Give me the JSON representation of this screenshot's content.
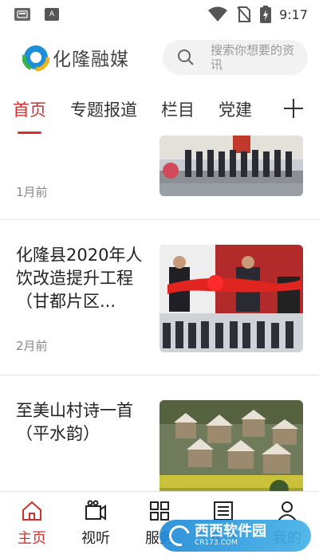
{
  "status_bar": {
    "left_icons": [
      "notification-icon",
      "app-a-icon"
    ],
    "app_a_text": "A",
    "right_icons": [
      "wifi-icon",
      "no-sim-icon",
      "battery-charging-icon"
    ],
    "time": "9:17"
  },
  "header": {
    "logo_text": "化隆融媒",
    "search_placeholder": "搜索你想要的资讯"
  },
  "tabs": [
    {
      "label": "首页",
      "active": true
    },
    {
      "label": "专题报道",
      "active": false
    },
    {
      "label": "栏目",
      "active": false
    },
    {
      "label": "党建",
      "active": false
    }
  ],
  "feed": [
    {
      "title": "",
      "time": "1月前",
      "image": "ceremony-group-photo"
    },
    {
      "title": "化隆县2020年人饮改造提升工程（甘都片区...",
      "time": "2月前",
      "image": "ribbon-cutting-event"
    },
    {
      "title": "至美山村诗一首（平水韵）",
      "time": "",
      "image": "mountain-village-landscape"
    }
  ],
  "bottom_nav": [
    {
      "label": "主页",
      "icon": "home-icon",
      "active": true
    },
    {
      "label": "视听",
      "icon": "video-icon",
      "active": false
    },
    {
      "label": "服务",
      "icon": "grid-icon",
      "active": false
    },
    {
      "label": "報道",
      "icon": "newspaper-icon",
      "active": false
    },
    {
      "label": "我的",
      "icon": "user-icon",
      "active": false
    }
  ],
  "watermark": {
    "text": "西西软件园",
    "sub": "CR173.COM"
  },
  "colors": {
    "accent": "#d42f2f",
    "text": "#222222",
    "muted": "#888888",
    "search_bg": "#f2f2f2"
  }
}
